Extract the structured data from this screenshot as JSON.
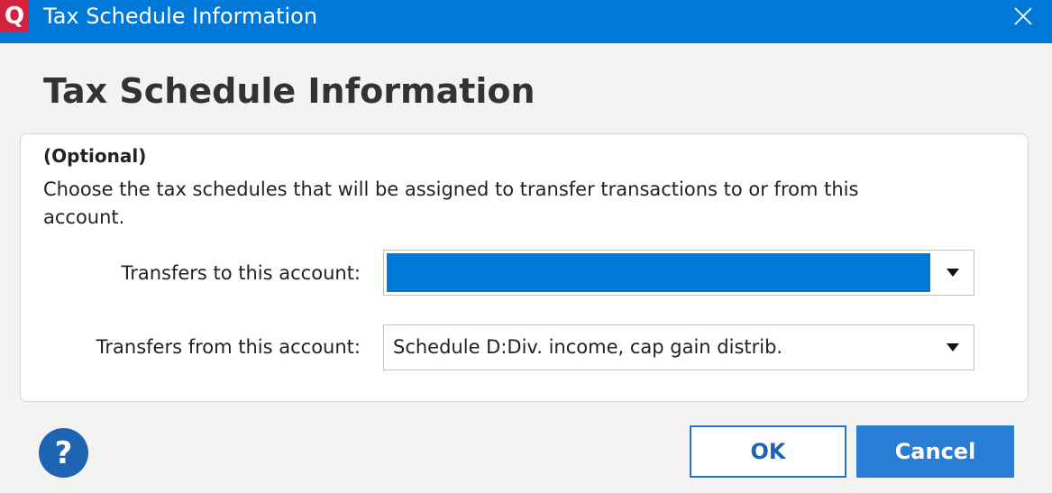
{
  "window": {
    "title": "Tax Schedule Information",
    "app_icon": "quicken-q-icon",
    "app_icon_glyph": "Q",
    "close_icon": "close-icon",
    "title_bar_color": "#0078d7"
  },
  "dialog": {
    "heading": "Tax Schedule Information",
    "optional_label": "(Optional)",
    "description": "Choose the tax schedules that will be assigned to transfer transactions to or from this account.",
    "transfers_to": {
      "label": "Transfers to this account:",
      "value": ""
    },
    "transfers_from": {
      "label": "Transfers from this account:",
      "value": "Schedule D:Div. income, cap gain distrib."
    }
  },
  "footer": {
    "help_glyph": "?",
    "ok_label": "OK",
    "cancel_label": "Cancel"
  },
  "colors": {
    "accent": "#0078d7",
    "button_blue": "#2a7dd6",
    "logo_red": "#d4213d"
  }
}
